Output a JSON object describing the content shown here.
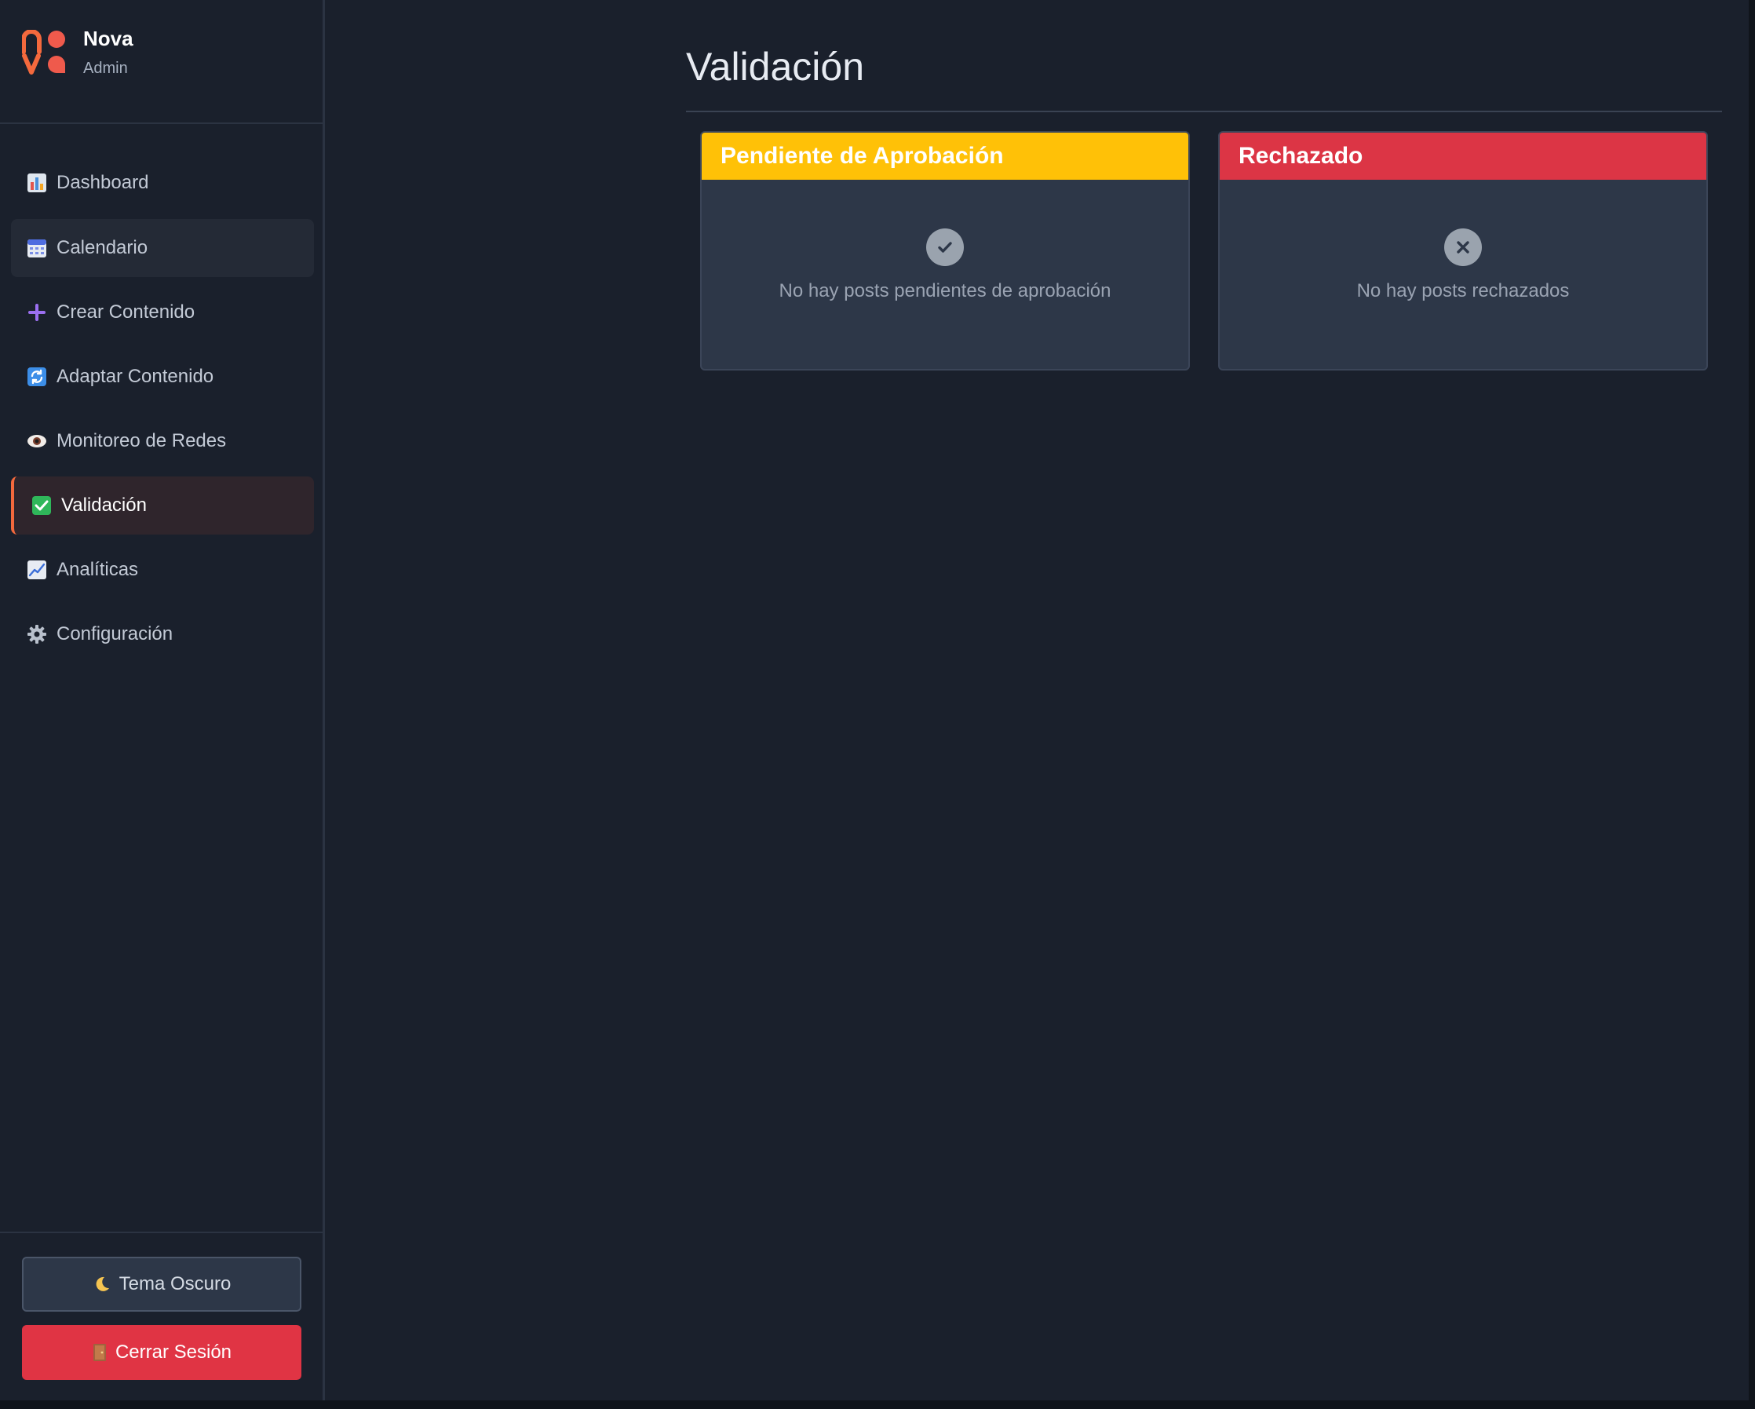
{
  "brand": {
    "name": "Nova",
    "role": "Admin",
    "logo_colors": {
      "primary": "#f4693d",
      "secondary": "#ef5a4c"
    }
  },
  "sidebar": {
    "items": [
      {
        "label": "Dashboard",
        "icon": "bar-chart-icon"
      },
      {
        "label": "Calendario",
        "icon": "calendar-icon"
      },
      {
        "label": "Crear Contenido",
        "icon": "plus-icon"
      },
      {
        "label": "Adaptar Contenido",
        "icon": "refresh-icon"
      },
      {
        "label": "Monitoreo de Redes",
        "icon": "eye-icon"
      },
      {
        "label": "Validación",
        "icon": "check-box-icon",
        "active": true
      },
      {
        "label": "Analíticas",
        "icon": "line-chart-icon"
      },
      {
        "label": "Configuración",
        "icon": "gear-icon"
      }
    ],
    "theme_button": {
      "label": "Tema Oscuro",
      "icon": "moon-icon"
    },
    "logout_button": {
      "label": "Cerrar Sesión",
      "icon": "door-icon"
    }
  },
  "main": {
    "title": "Validación",
    "cards": [
      {
        "title": "Pendiente de Aprobación",
        "color": "#ffc107",
        "icon": "check-circle-icon",
        "empty_message": "No hay posts pendientes de aprobación"
      },
      {
        "title": "Rechazado",
        "color": "#dc3545",
        "icon": "x-circle-icon",
        "empty_message": "No hay posts rechazados"
      }
    ]
  }
}
